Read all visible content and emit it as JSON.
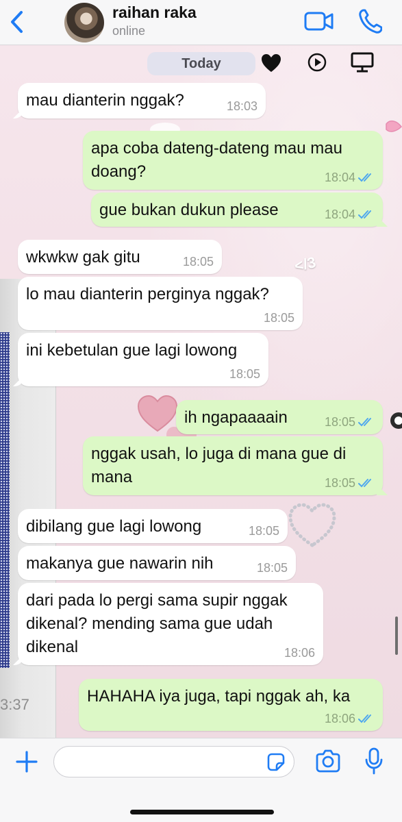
{
  "header": {
    "contact_name": "raihan raka",
    "status": "online"
  },
  "chat": {
    "date_label": "Today",
    "side_panel_time": "3:37",
    "sticker_text": "</3",
    "messages": [
      {
        "dir": "in",
        "text": "mau dianterin nggak?",
        "time": "18:03"
      },
      {
        "dir": "out",
        "text": "apa coba dateng-dateng mau mau doang?",
        "time": "18:04",
        "read": true
      },
      {
        "dir": "out",
        "text": "gue bukan dukun please",
        "time": "18:04",
        "read": true
      },
      {
        "dir": "in",
        "text": "wkwkw gak gitu",
        "time": "18:05"
      },
      {
        "dir": "in",
        "text": "lo mau dianterin perginya nggak?",
        "time": "18:05"
      },
      {
        "dir": "in",
        "text": "ini kebetulan gue lagi lowong",
        "time": "18:05"
      },
      {
        "dir": "out",
        "text": "ih ngapaaaain",
        "time": "18:05",
        "read": true
      },
      {
        "dir": "out",
        "text": "nggak usah, lo juga di mana gue di mana",
        "time": "18:05",
        "read": true
      },
      {
        "dir": "in",
        "text": "dibilang gue lagi lowong",
        "time": "18:05"
      },
      {
        "dir": "in",
        "text": "makanya gue nawarin nih",
        "time": "18:05"
      },
      {
        "dir": "in",
        "text": "dari pada lo pergi sama supir nggak dikenal? mending sama gue udah dikenal",
        "time": "18:06"
      },
      {
        "dir": "out",
        "text": "HAHAHA iya juga, tapi nggak ah, ka",
        "time": "18:06",
        "read": true
      }
    ]
  },
  "input": {
    "placeholder": ""
  },
  "colors": {
    "accent": "#1f7cf4",
    "incoming_bubble": "#ffffff",
    "outgoing_bubble": "#dcf8c6",
    "read_ticks": "#4fa7ee",
    "wallpaper": "#f3e0e7"
  },
  "icons": [
    "chevron-left-icon",
    "video-call-icon",
    "phone-icon",
    "heart-icon",
    "play-icon",
    "monitor-icon",
    "plus-icon",
    "sticker-icon",
    "camera-icon",
    "microphone-icon",
    "double-check-icon"
  ]
}
